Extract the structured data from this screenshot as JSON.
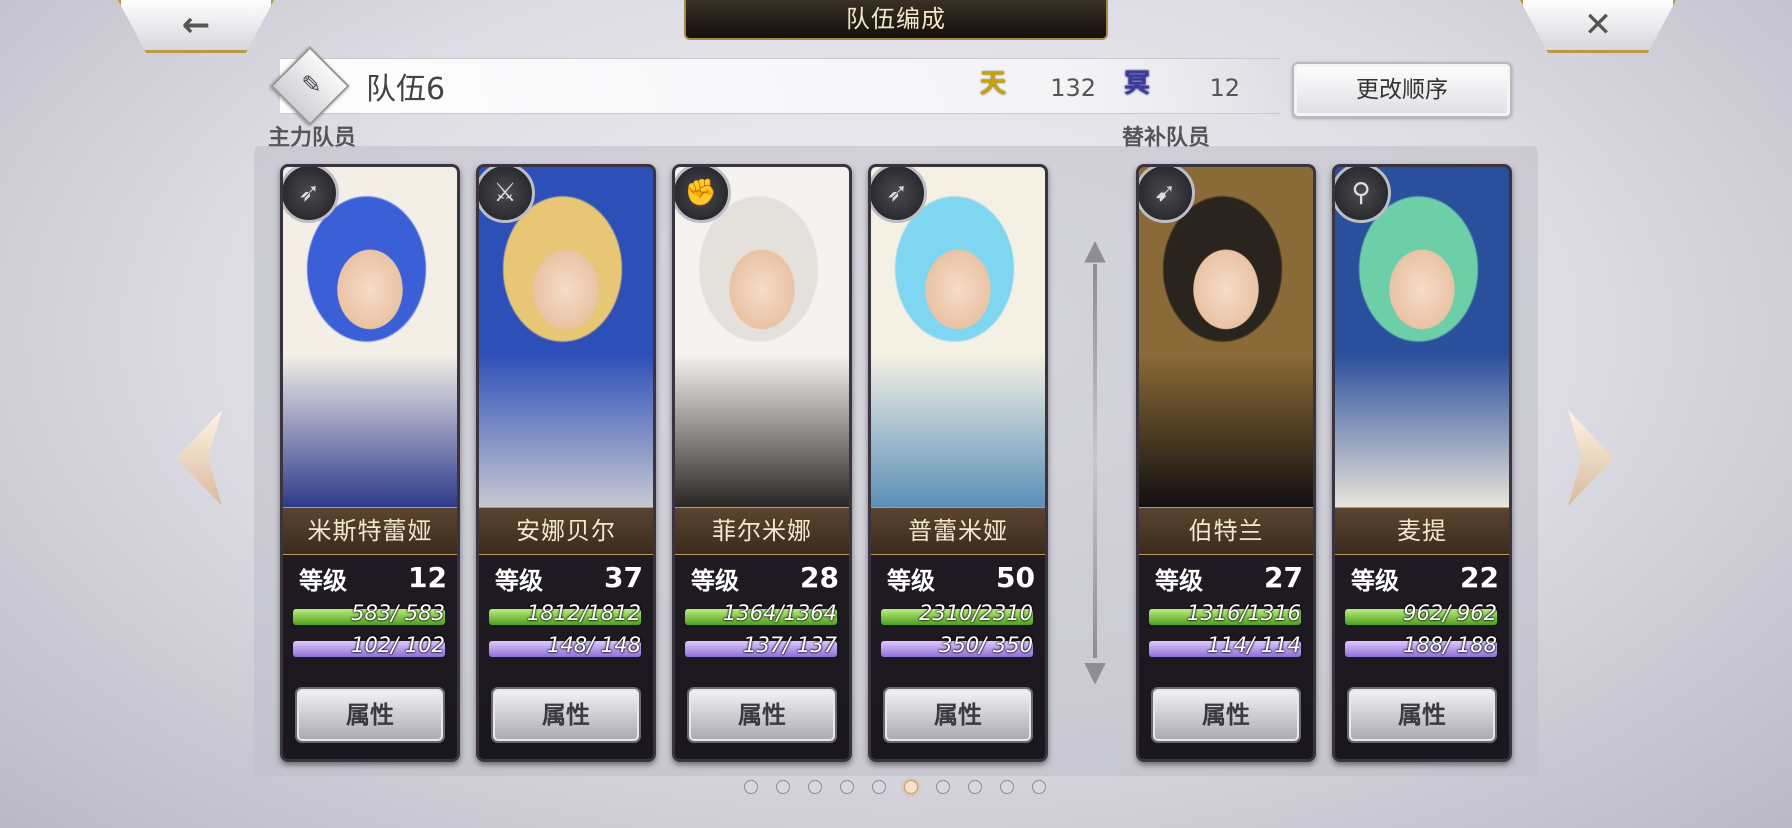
{
  "header": {
    "title": "队伍编成",
    "back_icon": "←",
    "close_icon": "✕"
  },
  "team": {
    "name": "队伍6",
    "edit_icon": "✎",
    "heaven": {
      "icon": "天",
      "value": "132"
    },
    "underworld": {
      "icon": "冥",
      "value": "12"
    },
    "reorder_label": "更改顺序"
  },
  "sections": {
    "main": "主力队员",
    "sub": "替补队员"
  },
  "level_label": "等级",
  "attr_label": "属性",
  "members": [
    {
      "name": "米斯特蕾娅",
      "level": "12",
      "hp": "583/ 583",
      "mp": "102/ 102",
      "hp_frac": 1,
      "mp_frac": 1,
      "weapon_icon": "➶",
      "weapon": "bow-icon",
      "colors": [
        "#3b5fd6",
        "#f3efe7",
        "#2d3a8c"
      ]
    },
    {
      "name": "安娜贝尔",
      "level": "37",
      "hp": "1812/1812",
      "mp": "148/ 148",
      "hp_frac": 1,
      "mp_frac": 1,
      "weapon_icon": "⚔",
      "weapon": "sword-icon",
      "colors": [
        "#e7c776",
        "#2d4fb8",
        "#c8c8d2"
      ]
    },
    {
      "name": "菲尔米娜",
      "level": "28",
      "hp": "1364/1364",
      "mp": "137/ 137",
      "hp_frac": 1,
      "mp_frac": 1,
      "weapon_icon": "✊",
      "weapon": "fist-icon",
      "colors": [
        "#e4e0dc",
        "#f5f3f0",
        "#2a2624"
      ]
    },
    {
      "name": "普蕾米娅",
      "level": "50",
      "hp": "2310/2310",
      "mp": "350/ 350",
      "hp_frac": 1,
      "mp_frac": 1,
      "weapon_icon": "➶",
      "weapon": "bow-icon",
      "colors": [
        "#7fd6f0",
        "#f4f0e4",
        "#5a8fb8"
      ]
    },
    {
      "name": "伯特兰",
      "level": "27",
      "hp": "1316/1316",
      "mp": "114/ 114",
      "hp_frac": 1,
      "mp_frac": 1,
      "weapon_icon": "➹",
      "weapon": "spear-icon",
      "colors": [
        "#2a241f",
        "#8a6a36",
        "#121010"
      ]
    },
    {
      "name": "麦提",
      "level": "22",
      "hp": "962/ 962",
      "mp": "188/ 188",
      "hp_frac": 1,
      "mp_frac": 1,
      "weapon_icon": "⚲",
      "weapon": "staff-icon",
      "colors": [
        "#6ccfa8",
        "#2a4f9c",
        "#e8e4da"
      ]
    }
  ],
  "pagination": {
    "count": 10,
    "active": 6
  }
}
